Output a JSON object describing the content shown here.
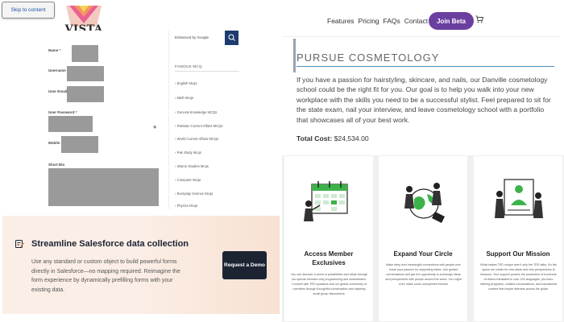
{
  "skip_link": "Skip to content",
  "logo": {
    "text": "VISTA",
    "subtext": "INSTITUTE"
  },
  "nav": {
    "links": [
      "Features",
      "Pricing",
      "FAQs",
      "Contact"
    ],
    "cta": "Join Beta"
  },
  "form": {
    "labels": [
      "Name",
      "Username",
      "User Email",
      "User Password",
      "Mobile",
      "Short Bio"
    ],
    "required_mark": "*"
  },
  "sidebar": {
    "search_text": "Enhanced by Google",
    "heading": "FAMOUS MCQ",
    "items": [
      "English Mcqs",
      "Math Mcqs",
      "General Knowledge MCQs",
      "Pakistan Current Affairs MCQs",
      "World Current Affairs MCQs",
      "Pak Study Mcqs",
      "Islamic Studies Mcqs",
      "Computer Mcqs",
      "Everyday Science Mcqs",
      "Physics Mcqs"
    ]
  },
  "salesforce": {
    "title": "Streamline Salesforce data collection",
    "description": "Use any standard or custom object to build powerful forms directly in Salesforce—no mapping required. Reimagine the form experience by dynamically prefilling forms with your existing data.",
    "button": "Request a Demo"
  },
  "cosmetology": {
    "title": "PURSUE COSMETOLOGY",
    "body": "If you have a passion for hairstyling, skincare, and nails, our Danville cosmetology school could be the right fit for you. Our goal is to help you walk into your new workplace with the skills you need to be a successful stylist. Feel prepared to sit for the state exam, nail your interview, and leave cosmetology school with a portfolio that showcases all of your best work.",
    "cost_label": "Total Cost:",
    "cost_value": "$24,534.00"
  },
  "cards": [
    {
      "title": "Access Member Exclusives",
      "icon": "calendar-icon",
      "description": "You can discover a world of possibilities and ideas through our special member-only programming and workstreams. Connect with TED speakers and our global community of members through thoughtful conversation and inspiring small group discussions."
    },
    {
      "title": "Expand Your Circle",
      "icon": "globe-people-icon",
      "description": "Make deep and meaningful connections with people who share your passion for supporting ideas. Join guided conversations and get the opportunity to exchange ideas and perspectives with people around the world. You might even make some unexpected friends!"
    },
    {
      "title": "Support Our Mission",
      "icon": "video-call-icon",
      "description": "What makes TED unique aren't only the TED talks. It's the space we create for new ideas and new perspectives to blossom. Your support powers the production of hundreds of videos translated in over 100 languages, pro-bono offering programs, curated conversations, and educational content that inspire listeners across the globe."
    }
  ],
  "colors": {
    "accent": "#6b3fa0",
    "navy": "#1d3b6e",
    "dark_button": "#1c2433",
    "banner_bg": "#fbeee6",
    "divider_blue": "#4a90c2"
  }
}
